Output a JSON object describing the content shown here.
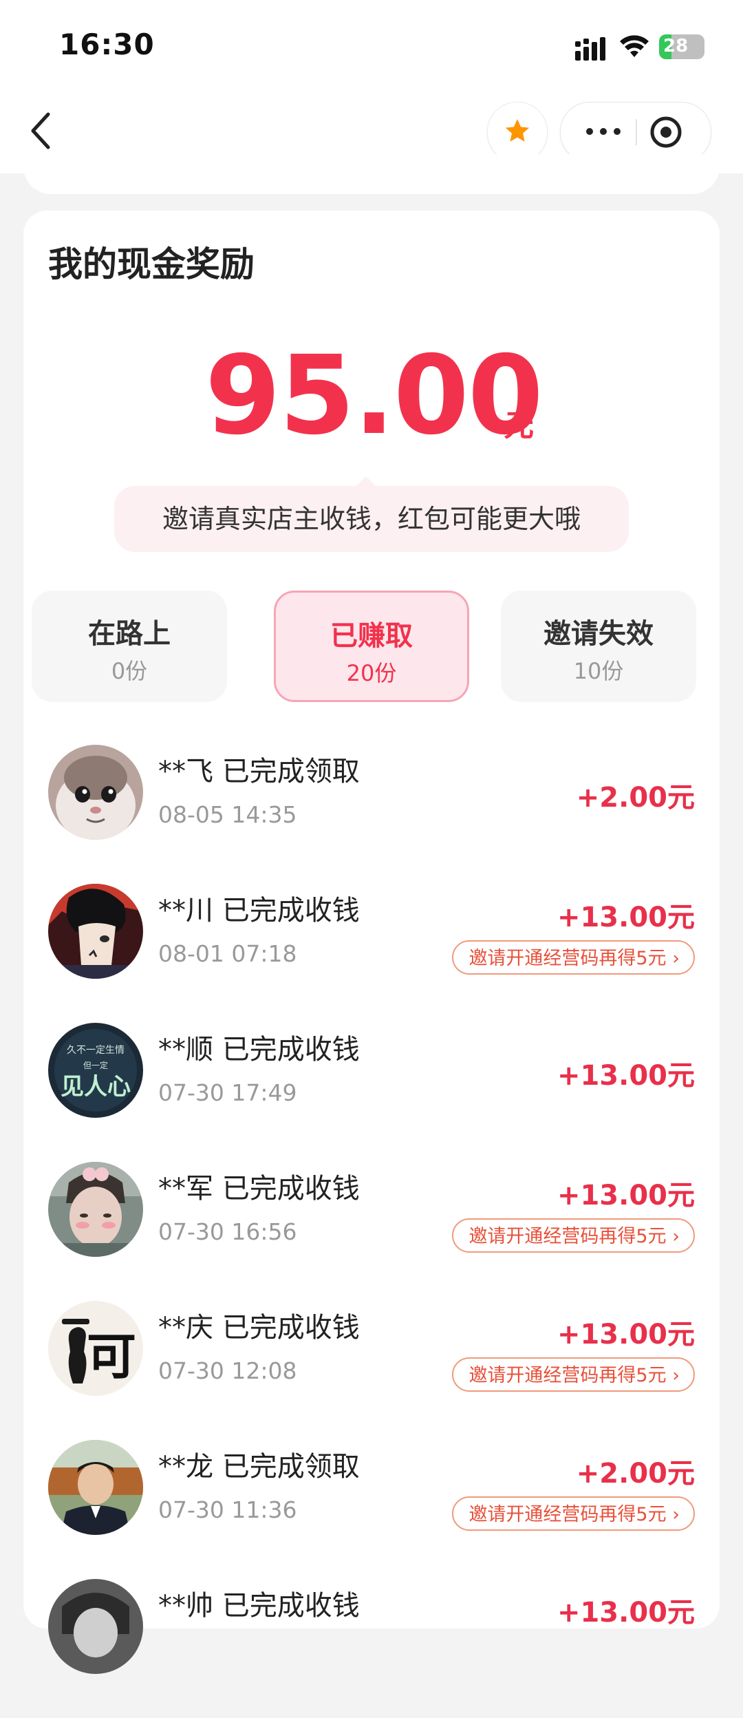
{
  "status_bar": {
    "time": "16:30",
    "battery": "28"
  },
  "page": {
    "title": "我的现金奖励",
    "amount": "95.00",
    "unit": "元",
    "tip": "邀请真实店主收钱，红包可能更大哦"
  },
  "tabs": [
    {
      "label": "在路上",
      "count": "0份",
      "active": false
    },
    {
      "label": "已赚取",
      "count": "20份",
      "active": true
    },
    {
      "label": "邀请失效",
      "count": "10份",
      "active": false
    }
  ],
  "records": [
    {
      "name": "**飞 已完成领取",
      "time": "08-05 14:35",
      "amount": "+2.00元",
      "invite": ""
    },
    {
      "name": "**川 已完成收钱",
      "time": "08-01 07:18",
      "amount": "+13.00元",
      "invite": "邀请开通经营码再得5元 ›"
    },
    {
      "name": "**顺 已完成收钱",
      "time": "07-30 17:49",
      "amount": "+13.00元",
      "invite": ""
    },
    {
      "name": "**军 已完成收钱",
      "time": "07-30 16:56",
      "amount": "+13.00元",
      "invite": "邀请开通经营码再得5元 ›"
    },
    {
      "name": "**庆 已完成收钱",
      "time": "07-30 12:08",
      "amount": "+13.00元",
      "invite": "邀请开通经营码再得5元 ›"
    },
    {
      "name": "**龙 已完成领取",
      "time": "07-30 11:36",
      "amount": "+2.00元",
      "invite": "邀请开通经营码再得5元 ›"
    },
    {
      "name": "**帅 已完成收钱",
      "time": "",
      "amount": "+13.00元",
      "invite": ""
    }
  ],
  "avatar_glyphs": {
    "shun_line1": "久不一定生情",
    "shun_line2": "但一定",
    "shun_line3": "见人心",
    "qing": "可"
  },
  "colors": {
    "accent": "#f2324d",
    "invite_border": "#f09a7b",
    "tab_active_bg": "#fde7ec",
    "star": "#ff9500"
  }
}
